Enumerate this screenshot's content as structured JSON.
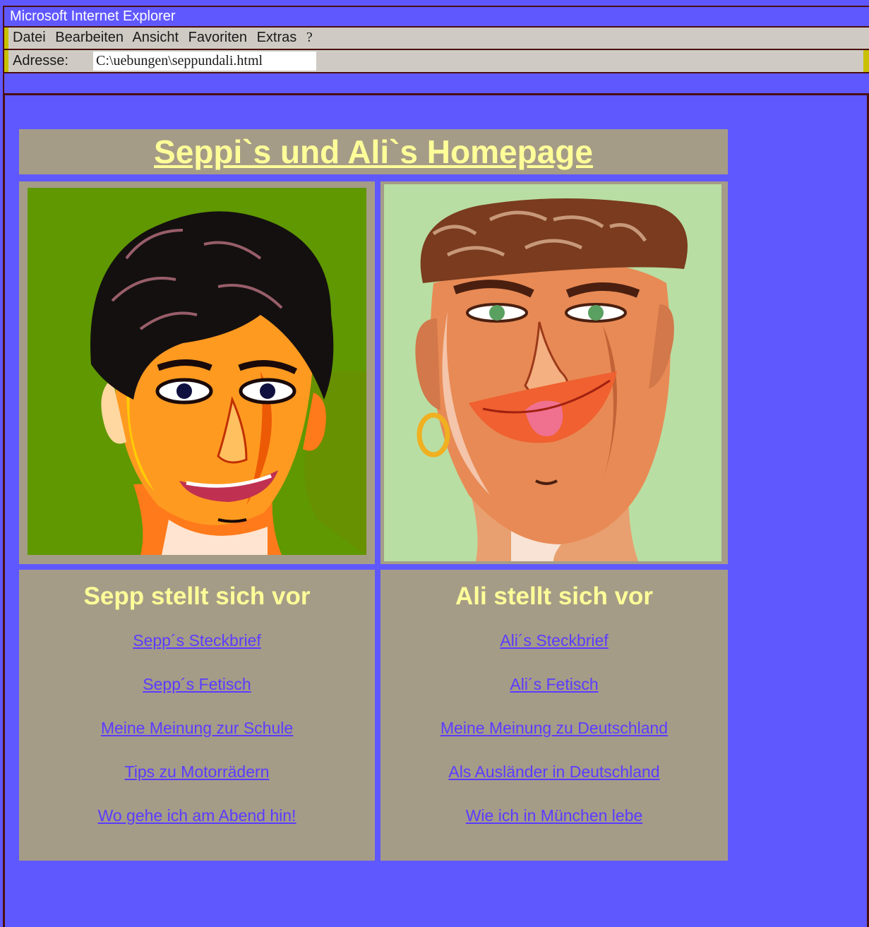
{
  "window": {
    "title": "Microsoft Internet Explorer"
  },
  "menu": {
    "items": [
      "Datei",
      "Bearbeiten",
      "Ansicht",
      "Favoriten",
      "Extras"
    ],
    "help": "?"
  },
  "address": {
    "label": "Adresse:",
    "value": "C:\\uebungen\\seppundali.html"
  },
  "page": {
    "title": "Seppi`s und Ali`s Homepage",
    "sepp": {
      "heading": "Sepp stellt sich vor",
      "links": [
        "Sepp´s Steckbrief",
        "Sepp´s Fetisch",
        "Meine Meinung zur Schule",
        "Tips zu Motorrädern",
        "Wo gehe ich am Abend hin!"
      ]
    },
    "ali": {
      "heading": "Ali stellt sich vor",
      "links": [
        "Ali´s Steckbrief",
        "Ali´s Fetisch",
        "Meine Meinung zu Deutschland",
        "Als Ausländer in Deutschland",
        "Wie ich in München lebe"
      ]
    }
  },
  "colors": {
    "background": "#6058ff",
    "panel": "#a59c87",
    "heading": "#ffff99",
    "link": "#5a3cff"
  }
}
